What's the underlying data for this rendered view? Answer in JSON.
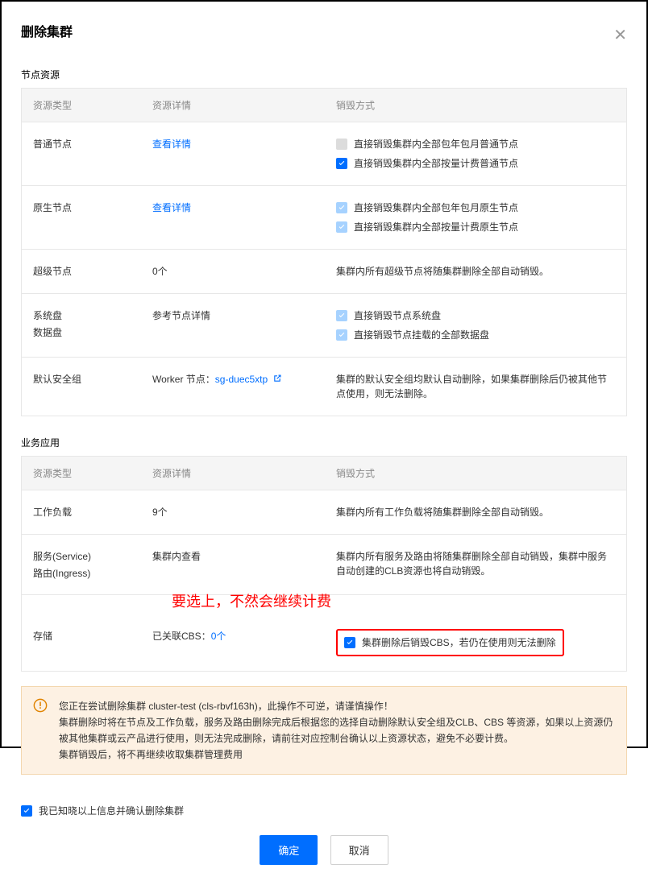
{
  "dialog": {
    "title": "删除集群"
  },
  "section_nodes": {
    "title": "节点资源",
    "headers": {
      "type": "资源类型",
      "detail": "资源详情",
      "method": "销毁方式"
    },
    "row_common": {
      "type": "普通节点",
      "detail_link": "查看详情",
      "opt1": "直接销毁集群内全部包年包月普通节点",
      "opt2": "直接销毁集群内全部按量计费普通节点"
    },
    "row_native": {
      "type": "原生节点",
      "detail_link": "查看详情",
      "opt1": "直接销毁集群内全部包年包月原生节点",
      "opt2": "直接销毁集群内全部按量计费原生节点"
    },
    "row_super": {
      "type": "超级节点",
      "detail": "0个",
      "method_text": "集群内所有超级节点将随集群删除全部自动销毁。"
    },
    "row_disk": {
      "type_line1": "系统盘",
      "type_line2": "数据盘",
      "detail": "参考节点详情",
      "opt1": "直接销毁节点系统盘",
      "opt2": "直接销毁节点挂载的全部数据盘"
    },
    "row_sg": {
      "type": "默认安全组",
      "detail_prefix": "Worker 节点：",
      "detail_link": "sg-duec5xtp",
      "method_text": "集群的默认安全组均默认自动删除，如果集群删除后仍被其他节点使用，则无法删除。"
    }
  },
  "section_apps": {
    "title": "业务应用",
    "headers": {
      "type": "资源类型",
      "detail": "资源详情",
      "method": "销毁方式"
    },
    "row_workload": {
      "type": "工作负载",
      "detail": "9个",
      "method_text": "集群内所有工作负载将随集群删除全部自动销毁。"
    },
    "row_service": {
      "type_line1": "服务(Service)",
      "type_line2": "路由(Ingress)",
      "detail": "集群内查看",
      "method_text": "集群内所有服务及路由将随集群删除全部自动销毁，集群中服务自动创建的CLB资源也将自动销毁。"
    },
    "row_storage": {
      "type": "存储",
      "detail_prefix": "已关联CBS：",
      "detail_link": "0个",
      "opt1": "集群删除后销毁CBS，若仍在使用则无法删除"
    }
  },
  "annotation": {
    "text": "要选上，不然会继续计费"
  },
  "warning": {
    "line1_prefix": "您正在尝试删除集群 cluster-test (cls-rbvf163h)，此操作不可逆，请谨慎操作！",
    "line2": "集群删除时将在节点及工作负载，服务及路由删除完成后根据您的选择自动删除默认安全组及CLB、CBS 等资源，如果以上资源仍被其他集群或云产品进行使用，则无法完成删除，请前往对应控制台确认以上资源状态，避免不必要计费。",
    "line3": "集群销毁后，将不再继续收取集群管理费用"
  },
  "confirm": {
    "label": "我已知晓以上信息并确认删除集群"
  },
  "buttons": {
    "ok": "确定",
    "cancel": "取消"
  }
}
